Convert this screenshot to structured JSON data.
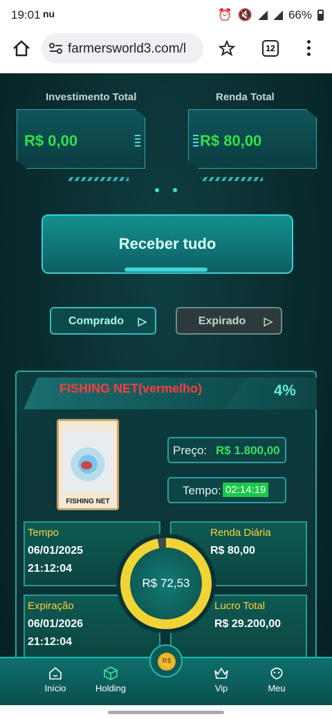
{
  "status_bar": {
    "time": "19:01",
    "carrier": "NU",
    "battery": "66%"
  },
  "browser": {
    "url": "farmersworld3.com/l",
    "tab_count": "12"
  },
  "summary": {
    "investment_label": "Investimento Total",
    "investment_value": "R$ 0,00",
    "income_label": "Renda Total",
    "income_value": "R$ 80,00"
  },
  "receive_all_label": "Receber tudo",
  "tabs": {
    "bought": "Comprado",
    "expired": "Expirado",
    "active": "bought"
  },
  "product": {
    "name": "FISHING NET(vermelho)",
    "percent": "4%",
    "card_label": "FISHING NET",
    "price_label": "Preço:",
    "price_value": "R$ 1.800,00",
    "time_label": "Tempo:",
    "time_value": "02:14:19",
    "start_label": "Tempo",
    "start_date": "06/01/2025",
    "start_time": "21:12:04",
    "daily_label": "Renda Diária",
    "daily_value": "R$ 80,00",
    "expiry_label": "Expiração",
    "expiry_date": "06/01/2026",
    "expiry_time": "21:12:04",
    "profit_label": "Lucro Total",
    "profit_value": "R$ 29.200,00",
    "center_value": "R$ 72,53",
    "progress_fraction": 0.97
  },
  "nav": {
    "home": "Início",
    "holding": "Holding",
    "center_icon": "R$",
    "vip": "Vip",
    "me": "Meu"
  },
  "colors": {
    "accent": "#2ea6a6",
    "money_green": "#33e04a",
    "title_red": "#ff3d3d",
    "label_yellow": "#ffd23b"
  }
}
